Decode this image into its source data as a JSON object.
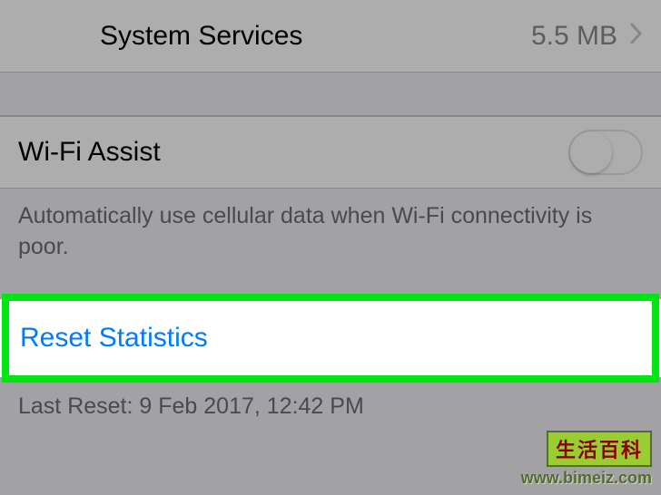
{
  "systemServices": {
    "label": "System Services",
    "value": "5.5 MB"
  },
  "wifiAssist": {
    "label": "Wi-Fi Assist",
    "enabled": false
  },
  "wifiAssistDescription": "Automatically use cellular data when Wi-Fi connectivity is poor.",
  "resetStatistics": {
    "label": "Reset Statistics"
  },
  "lastReset": "Last Reset: 9 Feb 2017, 12:42 PM",
  "watermark": {
    "title": "生活百科",
    "url": "www.bimeiz.com"
  }
}
